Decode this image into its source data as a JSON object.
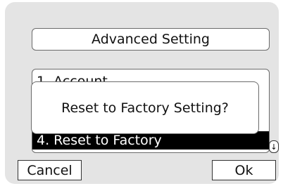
{
  "header": {
    "title": "Advanced Setting"
  },
  "menu": {
    "items": [
      {
        "label": "1. Account",
        "selected": false
      },
      {
        "label": "4. Reset to Factory",
        "selected": true
      }
    ]
  },
  "dialog": {
    "message": "Reset to Factory Setting?"
  },
  "softkeys": {
    "left": "Cancel",
    "right": "Ok"
  },
  "icons": {
    "scroll": "scroll-down-arrow-icon"
  },
  "colors": {
    "background": "#e4e4e4",
    "selected_row": "#000000"
  }
}
